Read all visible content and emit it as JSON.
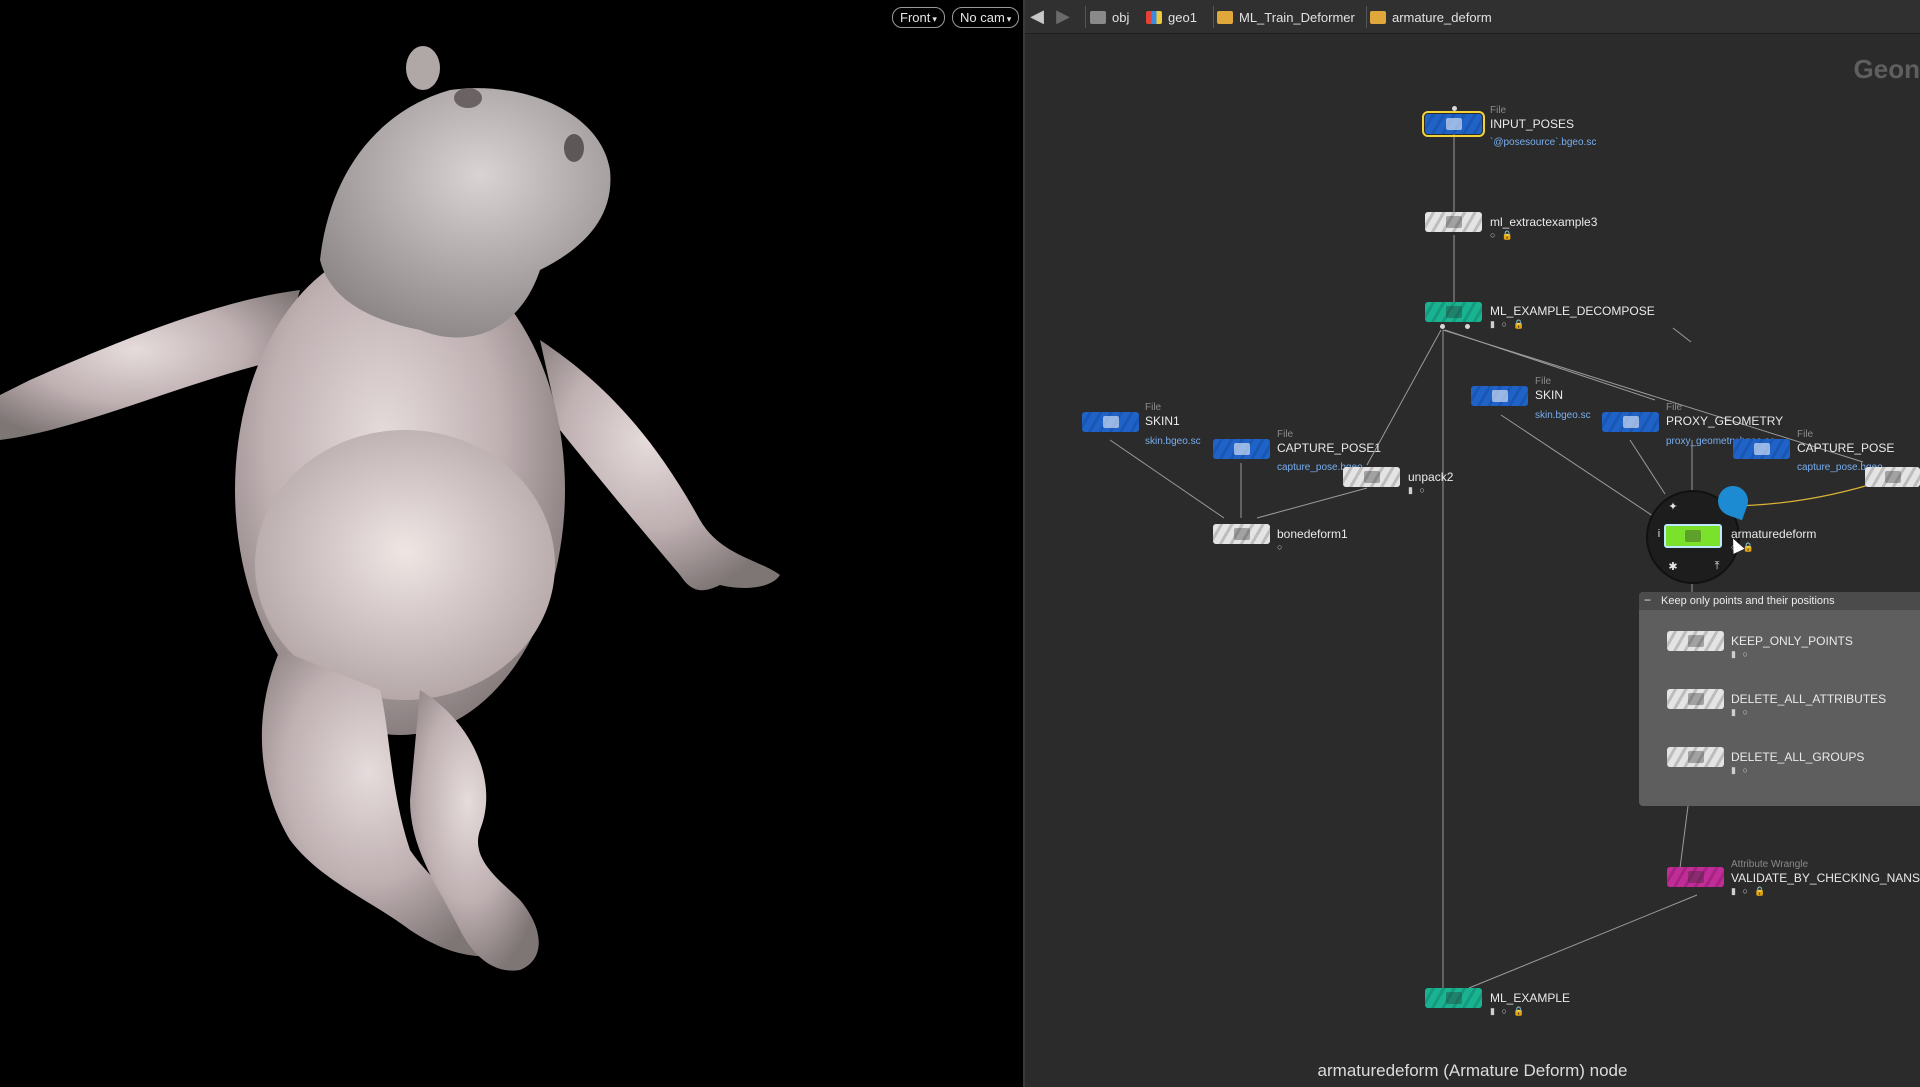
{
  "viewport": {
    "view_button": "Front",
    "camera_button": "No cam",
    "dropdown_glyph": "▾",
    "subject": "hippo character mesh"
  },
  "pathbar": {
    "back_icon": "arrow-left-icon",
    "forward_icon": "arrow-right-icon",
    "crumbs": [
      {
        "label": "obj",
        "icon": "obj-network-icon"
      },
      {
        "label": "geo1",
        "icon": "geo-icon"
      },
      {
        "label": "ML_Train_Deformer",
        "icon": "folder-icon"
      },
      {
        "label": "armature_deform",
        "icon": "folder-icon"
      }
    ]
  },
  "network": {
    "context_watermark": "Geon",
    "nodes": {
      "input_poses": {
        "type": "File",
        "name": "INPUT_POSES",
        "param": "`@posesource`.bgeo.sc"
      },
      "ml_extractexample3": {
        "name": "ml_extractexample3"
      },
      "ml_example_decompose": {
        "name": "ML_EXAMPLE_DECOMPOSE"
      },
      "skin1": {
        "type": "File",
        "name": "SKIN1",
        "param": "skin.bgeo.sc"
      },
      "capture_pose1": {
        "type": "File",
        "name": "CAPTURE_POSE1",
        "param": "capture_pose.bgeo"
      },
      "unpack2": {
        "name": "unpack2"
      },
      "bonedeform1": {
        "name": "bonedeform1"
      },
      "skin": {
        "type": "File",
        "name": "SKIN",
        "param": "skin.bgeo.sc"
      },
      "proxy_geometry": {
        "type": "File",
        "name": "PROXY_GEOMETRY",
        "param": "proxy_geometry.bgeo.sc"
      },
      "capture_pose": {
        "type": "File",
        "name": "CAPTURE_POSE",
        "param": "capture_pose.bgeo"
      },
      "armaturedeform": {
        "name": "armaturedeform"
      },
      "keep_only_points": {
        "name": "KEEP_ONLY_POINTS"
      },
      "delete_all_attributes": {
        "name": "DELETE_ALL_ATTRIBUTES"
      },
      "delete_all_groups": {
        "name": "DELETE_ALL_GROUPS"
      },
      "validate_by_checking_nans": {
        "type": "Attribute Wrangle",
        "name": "VALIDATE_BY_CHECKING_NANS"
      },
      "ml_example": {
        "name": "ML_EXAMPLE"
      }
    },
    "netbox": {
      "title": "Keep only points and their positions",
      "collapse_glyph": "−"
    },
    "flags": {
      "three": "▮ ○ 🔒",
      "two": "▮ ○",
      "one": "○",
      "lock": "○ 🔒"
    },
    "caption": "armaturedeform (Armature Deform) node"
  },
  "colors": {
    "file_node": "#1f63c9",
    "ml_node": "#19b391",
    "wrangle_node": "#c02c98",
    "selected_outline": "#f2d23a",
    "param_text": "#78aef0"
  }
}
